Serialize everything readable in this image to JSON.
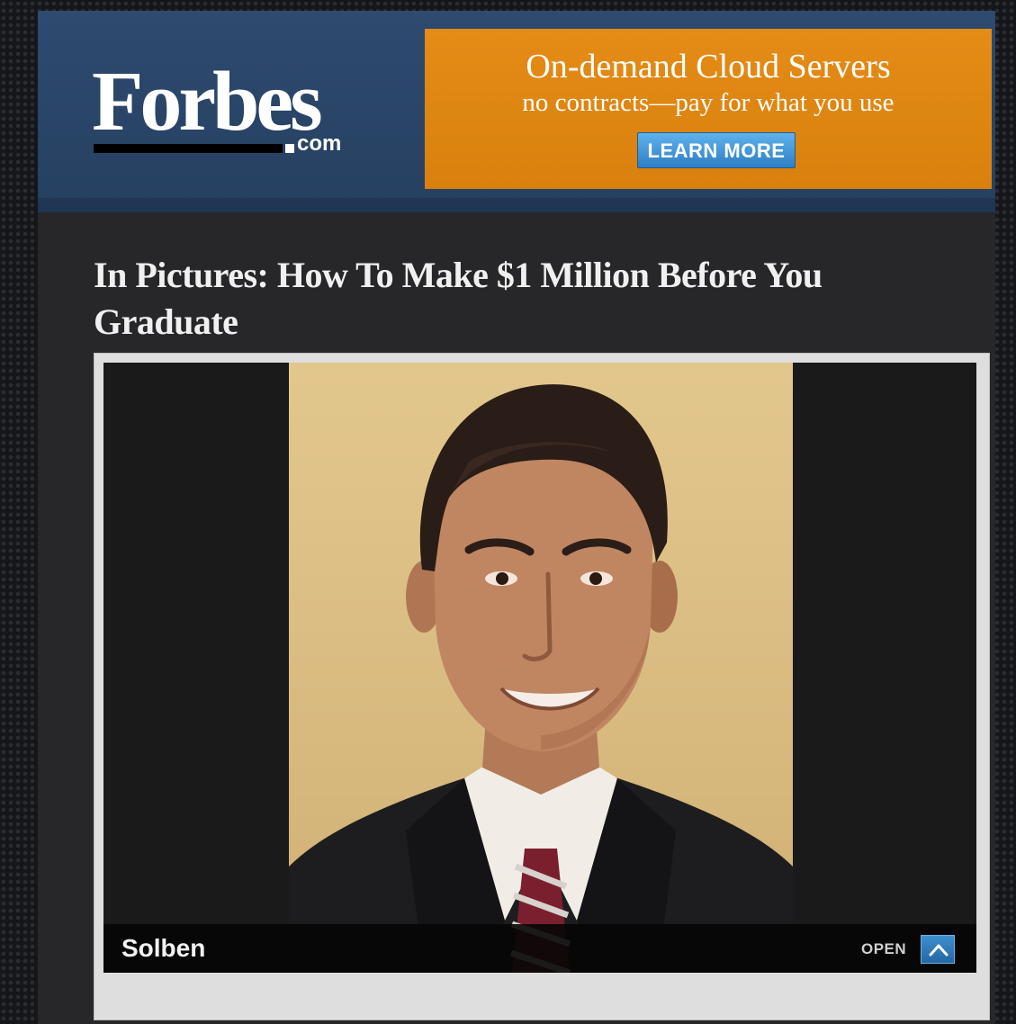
{
  "logo": {
    "word": "Forbes",
    "suffix": "com"
  },
  "ad": {
    "headline": "On-demand Cloud Servers",
    "subline": "no contracts—pay for what you use",
    "button_label": "LEARN MORE",
    "background_color": "#e08a14",
    "button_color": "#3b8fd6"
  },
  "article": {
    "title": "In Pictures: How To Make $1 Million Before You Graduate"
  },
  "slideshow": {
    "caption": "Solben",
    "open_label": "OPEN",
    "toggle_icon": "chevron-up-icon"
  },
  "colors": {
    "header_blue": "#2b4569",
    "page_bg": "#272729"
  }
}
